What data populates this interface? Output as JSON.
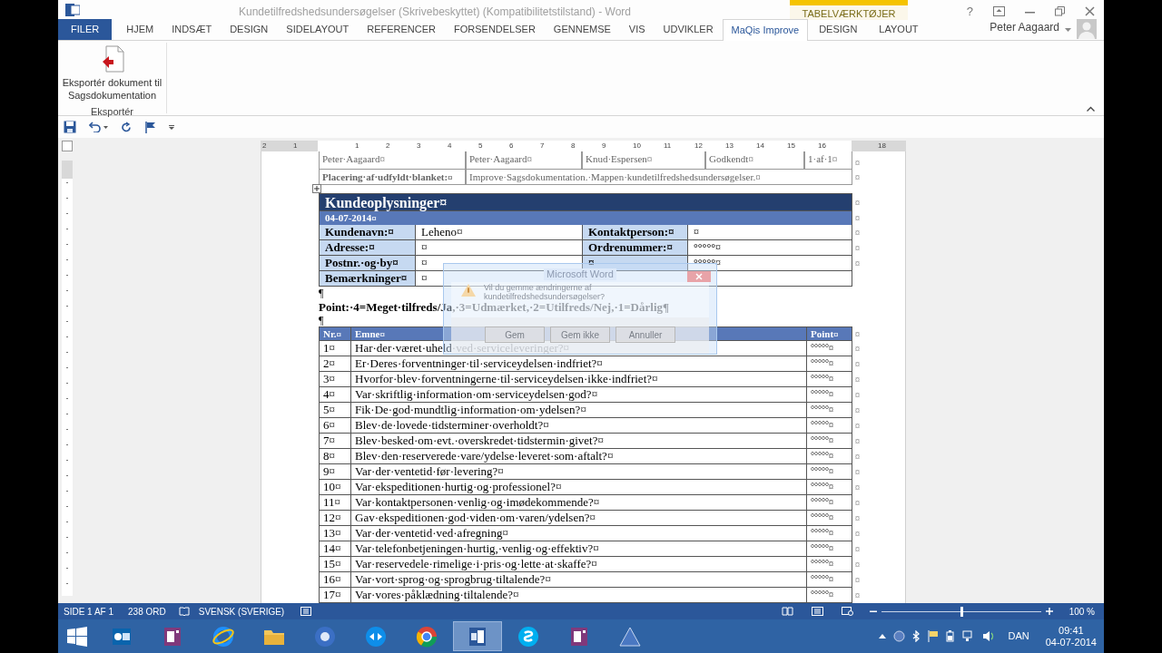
{
  "window": {
    "title": "Kundetilfredshedsundersøgelser (Skrivebeskyttet) (Kompatibilitetstilstand) - Word",
    "help": "?"
  },
  "ribbon": {
    "tabs": [
      {
        "label": "FILER",
        "kind": "file",
        "selected": false
      },
      {
        "label": "HJEM",
        "kind": "tab",
        "selected": false
      },
      {
        "label": "INDSÆT",
        "kind": "tab",
        "selected": false
      },
      {
        "label": "DESIGN",
        "kind": "tab",
        "selected": false
      },
      {
        "label": "SIDELAYOUT",
        "kind": "tab",
        "selected": false
      },
      {
        "label": "REFERENCER",
        "kind": "tab",
        "selected": false
      },
      {
        "label": "FORSENDELSER",
        "kind": "tab",
        "selected": false
      },
      {
        "label": "GENNEMSE",
        "kind": "tab",
        "selected": false
      },
      {
        "label": "VIS",
        "kind": "tab",
        "selected": false
      },
      {
        "label": "UDVIKLER",
        "kind": "tab",
        "selected": false
      },
      {
        "label": "MaQis Improve",
        "kind": "tab",
        "selected": true
      }
    ],
    "contextual": {
      "label": "TABELVÆRKTØJER",
      "tabs": [
        {
          "label": "DESIGN",
          "selected": false
        },
        {
          "label": "LAYOUT",
          "selected": false
        }
      ]
    },
    "user": "Peter Aagaard",
    "group": {
      "label": "Eksportér",
      "button": "Eksportér dokument til Sagsdokumentation"
    }
  },
  "ruler": [
    "2",
    "1",
    "1",
    "2",
    "3",
    "4",
    "5",
    "6",
    "7",
    "8",
    "9",
    "10",
    "11",
    "12",
    "13",
    "14",
    "15",
    "16",
    "18"
  ],
  "document": {
    "header_table": {
      "rows": [
        {
          "cells": [
            "Peter·Aagaard¤",
            "Peter·Aagaard¤",
            "Knud·Espersen¤",
            "Godkendt¤",
            "1·af·1¤"
          ],
          "end": "¤"
        },
        {
          "cells": [
            "Placering·af·udfyldt·blanket:¤",
            "Improve·Sagsdokumentation.·Mappen·kundetilfredshedsundersøgelser.¤"
          ],
          "end": "¤"
        }
      ]
    },
    "customer_table": {
      "title": "Kundeoplysninger¤",
      "title_end": "¤",
      "date": "04-07-2014¤",
      "date_end": "¤",
      "rows": [
        {
          "label": "Kundenavn:¤",
          "value": "Leheno¤",
          "label2": "Kontaktperson:¤",
          "value2": "¤",
          "end": "¤"
        },
        {
          "label": "Adresse:¤",
          "value": "¤",
          "label2": "Ordrenummer:¤",
          "value2": "°°°°°¤",
          "end": "¤"
        },
        {
          "label": "Postnr.·og·by¤",
          "value": "¤",
          "label2": "¤",
          "value2": "°°°°°¤",
          "end": "¤"
        },
        {
          "label": "Bemærkninger¤",
          "value": "¤"
        }
      ]
    },
    "paragraphs": [
      "¶",
      "Point:·4=Meget·tilfreds/Ja,·3=Udmærket,·2=Utilfreds/Nej,·1=Dårlig¶",
      "¶"
    ],
    "survey_table": {
      "columns": [
        "Nr.¤",
        "Emne¤",
        "Point¤"
      ],
      "header_end": "¤",
      "rows": [
        {
          "nr": "1¤",
          "topic": "Har·der·været·uheld·ved·serviceleveringer?¤",
          "points": "°°°°°¤",
          "end": "¤"
        },
        {
          "nr": "2¤",
          "topic": "Er·Deres·forventninger·til·serviceydelsen·indfriet?¤",
          "points": "°°°°°¤",
          "end": "¤"
        },
        {
          "nr": "3¤",
          "topic": "Hvorfor·blev·forventningerne·til·serviceydelsen·ikke·indfriet?¤",
          "points": "°°°°°¤",
          "end": "¤"
        },
        {
          "nr": "4¤",
          "topic": "Var·skriftlig·information·om·serviceydelsen·god?¤",
          "points": "°°°°°¤",
          "end": "¤"
        },
        {
          "nr": "5¤",
          "topic": "Fik·De·god·mundtlig·information·om·ydelsen?¤",
          "points": "°°°°°¤",
          "end": "¤"
        },
        {
          "nr": "6¤",
          "topic": "Blev·de·lovede·tidsterminer·overholdt?¤",
          "points": "°°°°°¤",
          "end": "¤"
        },
        {
          "nr": "7¤",
          "topic": "Blev·besked·om·evt.·overskredet·tidstermin·givet?¤",
          "points": "°°°°°¤",
          "end": "¤"
        },
        {
          "nr": "8¤",
          "topic": "Blev·den·reserverede·vare/ydelse·leveret·som·aftalt?¤",
          "points": "°°°°°¤",
          "end": "¤"
        },
        {
          "nr": "9¤",
          "topic": "Var·der·ventetid·før·levering?¤",
          "points": "°°°°°¤",
          "end": "¤"
        },
        {
          "nr": "10¤",
          "topic": "Var·ekspeditionen·hurtig·og·professionel?¤",
          "points": "°°°°°¤",
          "end": "¤"
        },
        {
          "nr": "11¤",
          "topic": "Var·kontaktpersonen·venlig·og·imødekommende?¤",
          "points": "°°°°°¤",
          "end": "¤"
        },
        {
          "nr": "12¤",
          "topic": "Gav·ekspeditionen·god·viden·om·varen/ydelsen?¤",
          "points": "°°°°°¤",
          "end": "¤"
        },
        {
          "nr": "13¤",
          "topic": "Var·der·ventetid·ved·afregning¤",
          "points": "°°°°°¤",
          "end": "¤"
        },
        {
          "nr": "14¤",
          "topic": "Var·telefonbetjeningen·hurtig,·venlig·og·effektiv?¤",
          "points": "°°°°°¤",
          "end": "¤"
        },
        {
          "nr": "15¤",
          "topic": "Var·reservedele·rimelige·i·pris·og·lette·at·skaffe?¤",
          "points": "°°°°°¤",
          "end": "¤"
        },
        {
          "nr": "16¤",
          "topic": "Var·vort·sprog·og·sprogbrug·tiltalende?¤",
          "points": "°°°°°¤",
          "end": "¤"
        },
        {
          "nr": "17¤",
          "topic": "Var·vores·påklædning·tiltalende?¤",
          "points": "°°°°°¤",
          "end": "¤"
        }
      ]
    }
  },
  "dialog": {
    "title": "Microsoft Word",
    "message": "Vil du gemme ændringerne af kundetilfredshedsundersøgelser?",
    "buttons": [
      "Gem",
      "Gem ikke",
      "Annuller"
    ]
  },
  "status_bar": {
    "page": "SIDE 1 AF 1",
    "words": "238 ORD",
    "language": "SVENSK (SVERIGE)",
    "zoom": {
      "level": 0.5,
      "label": "100 %"
    }
  },
  "taskbar": {
    "apps": [
      {
        "kind": "mail",
        "selected": false
      },
      {
        "kind": "notebook",
        "selected": false
      },
      {
        "kind": "browser",
        "selected": false
      },
      {
        "kind": "folder",
        "selected": false
      },
      {
        "kind": "media",
        "selected": false
      },
      {
        "kind": "remote",
        "selected": false
      },
      {
        "kind": "globe",
        "selected": false
      },
      {
        "kind": "document",
        "selected": true
      },
      {
        "kind": "chat",
        "selected": false
      },
      {
        "kind": "notebook",
        "selected": false
      },
      {
        "kind": "triangle",
        "selected": false
      }
    ],
    "tray": {
      "language": "DAN",
      "time": "09:41",
      "date": "04-07-2014"
    }
  }
}
